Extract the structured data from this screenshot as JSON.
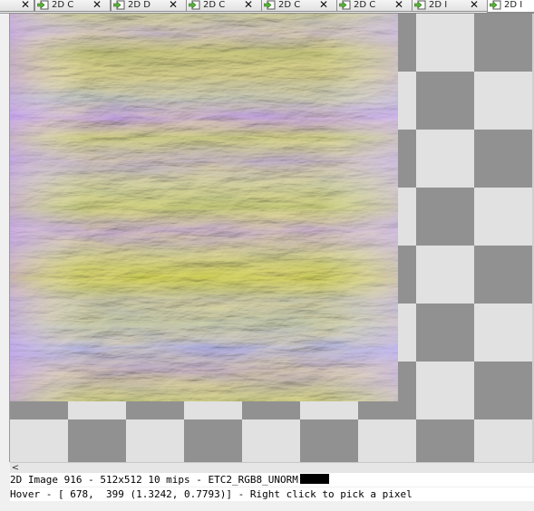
{
  "tabs": [
    {
      "label": "",
      "icon": "none",
      "close": "✕",
      "active": false
    },
    {
      "label": "2D C",
      "icon": "arrow-image-icon",
      "close": "✕",
      "active": false
    },
    {
      "label": "2D D",
      "icon": "arrow-image-icon",
      "close": "✕",
      "active": false
    },
    {
      "label": "2D C",
      "icon": "arrow-image-icon",
      "close": "✕",
      "active": false
    },
    {
      "label": "2D C",
      "icon": "arrow-image-icon",
      "close": "✕",
      "active": false
    },
    {
      "label": "2D C",
      "icon": "arrow-image-icon",
      "close": "✕",
      "active": false
    },
    {
      "label": "2D I",
      "icon": "arrow-image-icon",
      "close": "✕",
      "active": false
    },
    {
      "label": "2D I",
      "icon": "arrow-image-icon",
      "close": "",
      "active": true
    }
  ],
  "viewer": {
    "checker_light": "#e1e1e1",
    "checker_dark": "#919191"
  },
  "scrollbar": {
    "left_arrow": "<"
  },
  "status": {
    "info": "2D Image 916 - 512x512 10 mips - ETC2_RGB8_UNORM",
    "info_swatch_color": "#000000",
    "hover": "Hover - [ 678,  399 (1.3242, 0.7793)] - Right click to pick a pixel"
  }
}
